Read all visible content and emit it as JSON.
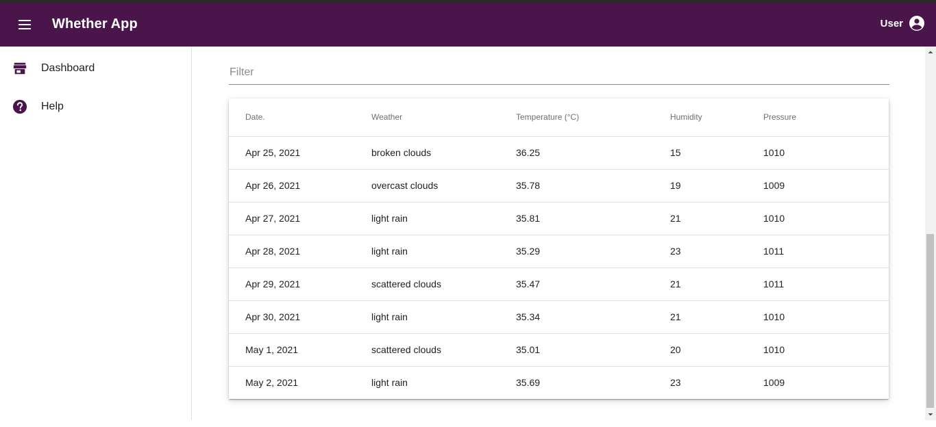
{
  "app": {
    "title": "Whether App",
    "user_label": "User",
    "brand_color": "#4a154b"
  },
  "icons": {
    "menu": "menu-icon",
    "user": "account-circle-icon",
    "dashboard": "store-icon",
    "help": "help-circle-icon"
  },
  "sidebar": {
    "items": [
      {
        "label": "Dashboard",
        "icon": "store-icon"
      },
      {
        "label": "Help",
        "icon": "help-circle-icon"
      }
    ]
  },
  "filter": {
    "placeholder": "Filter",
    "value": ""
  },
  "table": {
    "columns": [
      "Date.",
      "Weather",
      "Temperature (°C)",
      "Humidity",
      "Pressure"
    ],
    "rows": [
      [
        "Apr 25, 2021",
        "broken clouds",
        "36.25",
        "15",
        "1010"
      ],
      [
        "Apr 26, 2021",
        "overcast clouds",
        "35.78",
        "19",
        "1009"
      ],
      [
        "Apr 27, 2021",
        "light rain",
        "35.81",
        "21",
        "1010"
      ],
      [
        "Apr 28, 2021",
        "light rain",
        "35.29",
        "23",
        "1011"
      ],
      [
        "Apr 29, 2021",
        "scattered clouds",
        "35.47",
        "21",
        "1011"
      ],
      [
        "Apr 30, 2021",
        "light rain",
        "35.34",
        "21",
        "1010"
      ],
      [
        "May 1, 2021",
        "scattered clouds",
        "35.01",
        "20",
        "1010"
      ],
      [
        "May 2, 2021",
        "light rain",
        "35.69",
        "23",
        "1009"
      ]
    ]
  }
}
